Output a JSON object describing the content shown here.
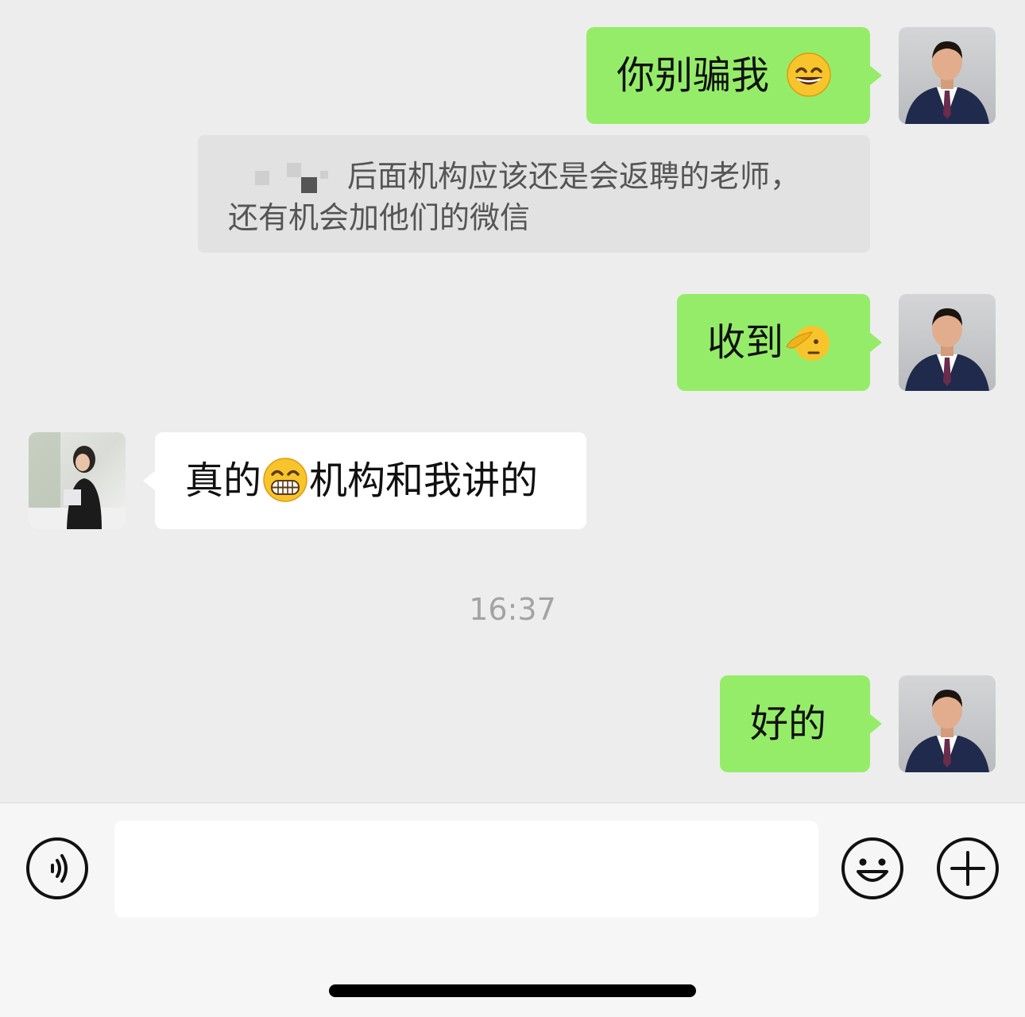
{
  "messages": [
    {
      "from": "me",
      "text": "你别骗我",
      "emoji": "grinning-face-with-smiling-eyes"
    },
    {
      "quote_text_line1": "后面机构应该还是会返聘的老师，",
      "quote_text_line2": "还有机会加他们的微信"
    },
    {
      "from": "me",
      "text": "收到",
      "emoji": "saluting-face"
    },
    {
      "from": "other",
      "text_before": "真的",
      "text_after": "机构和我讲的",
      "emoji": "grimacing-face"
    },
    {
      "from": "me",
      "text": "好的"
    }
  ],
  "timestamp": "16:37",
  "input_bar": {
    "placeholder": "",
    "value": ""
  },
  "icons": {
    "voice": "voice-icon",
    "emoji": "emoji-icon",
    "more": "plus-icon"
  },
  "colors": {
    "background": "#ededed",
    "my_bubble": "#95ec69",
    "other_bubble": "#ffffff"
  }
}
